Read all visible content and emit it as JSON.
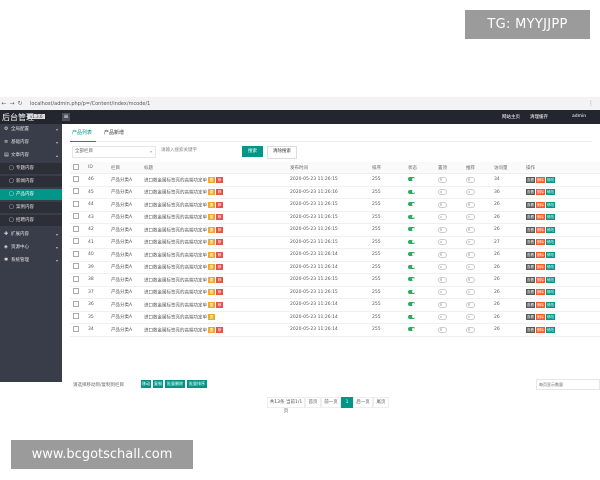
{
  "watermarks": {
    "tg": "TG: MYYJJPP",
    "url": "www.bcgotschall.com"
  },
  "browser": {
    "url": "localhost/admin.php/p=/Content/index/mcode/1"
  },
  "header": {
    "brand": "后台管理",
    "brand_badge": "v1.3.6",
    "home_link": "网站主页",
    "clear_cache": "清理缓存",
    "user": "admin"
  },
  "sidebar": {
    "items": [
      {
        "label": "全局配置",
        "icon": "gear-icon",
        "glyph": "⚙"
      },
      {
        "label": "基础内容",
        "icon": "list-icon",
        "glyph": "≡"
      },
      {
        "label": "文章内容",
        "icon": "file-icon",
        "glyph": "▤"
      },
      {
        "label": "专题内容",
        "icon": "doc-icon",
        "glyph": "▢"
      },
      {
        "label": "新闻内容",
        "icon": "doc-icon",
        "glyph": "▢"
      },
      {
        "label": "产品内容",
        "icon": "doc-icon",
        "glyph": "▢"
      },
      {
        "label": "案例内容",
        "icon": "doc-icon",
        "glyph": "▢"
      },
      {
        "label": "招聘内容",
        "icon": "doc-icon",
        "glyph": "▢"
      },
      {
        "label": "扩展内容",
        "icon": "puzzle-icon",
        "glyph": "✚"
      },
      {
        "label": "资源中心",
        "icon": "box-icon",
        "glyph": "◈"
      },
      {
        "label": "系统管理",
        "icon": "settings-icon",
        "glyph": "✱"
      }
    ]
  },
  "tabs": [
    "产品列表",
    "产品新增"
  ],
  "filter": {
    "category_placeholder": "全部栏目",
    "search_placeholder": "请输入搜索关键字",
    "search_button": "搜索",
    "clear_button": "清除搜索"
  },
  "table": {
    "headers": [
      "ID",
      "栏目",
      "标题",
      "发布时间",
      "排序",
      "状态",
      "置顶",
      "推荐",
      "访问量",
      "操作"
    ],
    "title_text": "进口数金属标签亮的高端功定单",
    "badges": {
      "a": "置",
      "b": "荐"
    },
    "actions": {
      "view": "查看",
      "delete": "删除",
      "edit": "修改"
    },
    "rows": [
      {
        "id": "46",
        "cat": "产品分类A",
        "time": "2020-05-23 11:26:15",
        "sort": "255",
        "visits": "34",
        "badges": 2
      },
      {
        "id": "45",
        "cat": "产品分类A",
        "time": "2020-05-23 11:26:16",
        "sort": "255",
        "visits": "36",
        "badges": 2
      },
      {
        "id": "44",
        "cat": "产品分类A",
        "time": "2020-05-23 11:26:15",
        "sort": "255",
        "visits": "26",
        "badges": 2
      },
      {
        "id": "43",
        "cat": "产品分类A",
        "time": "2020-05-23 11:26:15",
        "sort": "255",
        "visits": "26",
        "badges": 2
      },
      {
        "id": "42",
        "cat": "产品分类A",
        "time": "2020-05-23 11:26:15",
        "sort": "255",
        "visits": "26",
        "badges": 2
      },
      {
        "id": "41",
        "cat": "产品分类A",
        "time": "2020-05-23 11:26:15",
        "sort": "255",
        "visits": "27",
        "badges": 2
      },
      {
        "id": "40",
        "cat": "产品分类A",
        "time": "2020-05-23 11:26:14",
        "sort": "255",
        "visits": "26",
        "badges": 2
      },
      {
        "id": "39",
        "cat": "产品分类A",
        "time": "2020-05-23 11:26:14",
        "sort": "255",
        "visits": "26",
        "badges": 2
      },
      {
        "id": "38",
        "cat": "产品分类A",
        "time": "2020-05-23 11:26:15",
        "sort": "255",
        "visits": "26",
        "badges": 2
      },
      {
        "id": "37",
        "cat": "产品分类A",
        "time": "2020-05-23 11:26:15",
        "sort": "255",
        "visits": "26",
        "badges": 2
      },
      {
        "id": "36",
        "cat": "产品分类A",
        "time": "2020-05-23 11:26:14",
        "sort": "255",
        "visits": "26",
        "badges": 2
      },
      {
        "id": "35",
        "cat": "产品分类A",
        "time": "2020-05-23 11:26:14",
        "sort": "255",
        "visits": "26",
        "badges": 1
      },
      {
        "id": "34",
        "cat": "产品分类A",
        "time": "2020-05-23 11:26:14",
        "sort": "255",
        "visits": "26",
        "badges": 2
      }
    ]
  },
  "bulk": {
    "label": "请选择移动到/复制到栏目",
    "buttons": [
      "移动",
      "复制",
      "批量删除",
      "批量排序"
    ],
    "page_size": "每页显示数量"
  },
  "pager": {
    "info": "共13条 当前1/1页",
    "first": "首页",
    "prev": "前一页",
    "current": "1",
    "next": "后一页",
    "last": "尾页"
  },
  "colors": {
    "accent": "#009688",
    "sidebar": "#393d49",
    "topbar": "#23262e"
  }
}
